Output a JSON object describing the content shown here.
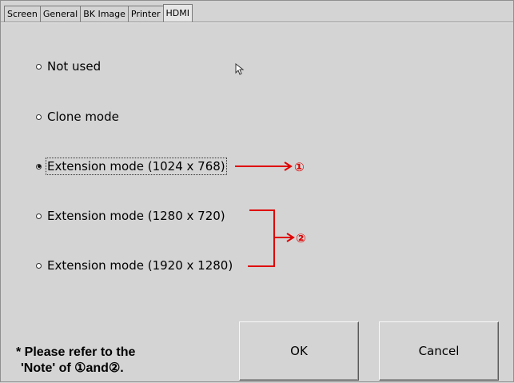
{
  "tabs": [
    {
      "label": "Screen"
    },
    {
      "label": "General"
    },
    {
      "label": "BK Image"
    },
    {
      "label": "Printer"
    },
    {
      "label": "HDMI",
      "active": true
    }
  ],
  "options": [
    {
      "label": "Not used",
      "selected": false
    },
    {
      "label": "Clone mode",
      "selected": false
    },
    {
      "label": "Extension mode (1024 x 768)",
      "selected": true
    },
    {
      "label": "Extension mode (1280 x 720)",
      "selected": false
    },
    {
      "label": "Extension mode (1920 x 1280)",
      "selected": false
    }
  ],
  "annotations": {
    "marker_1": "①",
    "marker_2": "②",
    "color": "#e00000"
  },
  "buttons": {
    "ok": "OK",
    "cancel": "Cancel"
  },
  "note": {
    "line1": "* Please refer to the",
    "line2": "'Note' of ①and②."
  }
}
